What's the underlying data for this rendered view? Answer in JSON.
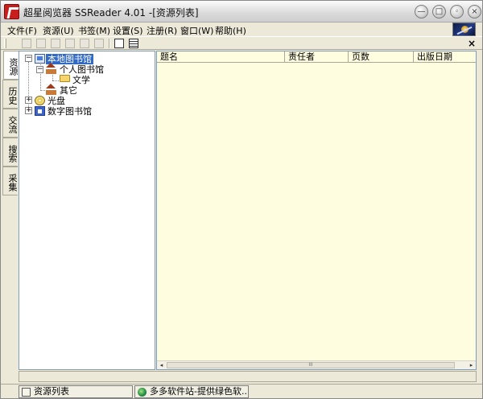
{
  "window": {
    "title": "超星阅览器 SSReader 4.01 -[资源列表]",
    "controls": [
      "—",
      "□",
      "◦",
      "×"
    ]
  },
  "menubar": {
    "items": [
      "文件(F)",
      "资源(U)",
      "书签(M)",
      "设置(S)",
      "注册(R)",
      "窗口(W)",
      "帮助(H)"
    ]
  },
  "toolbar": {
    "close_label": "×"
  },
  "side_tabs": [
    "资源",
    "历史",
    "交流",
    "搜索",
    "采集"
  ],
  "tree": {
    "root": "本地图书馆",
    "personal": "个人图书馆",
    "literature": "文学",
    "other": "其它",
    "disc": "光盘",
    "digital": "数字图书馆",
    "expand_minus": "−",
    "expand_plus": "+"
  },
  "list": {
    "columns": [
      "题名",
      "责任者",
      "页数",
      "出版日期"
    ],
    "rows": [],
    "scroll_left": "◂",
    "scroll_right": "▸",
    "thumb_grip": "III"
  },
  "taskbar": {
    "items": [
      "资源列表",
      "多多软件站-提供绿色软..."
    ]
  }
}
